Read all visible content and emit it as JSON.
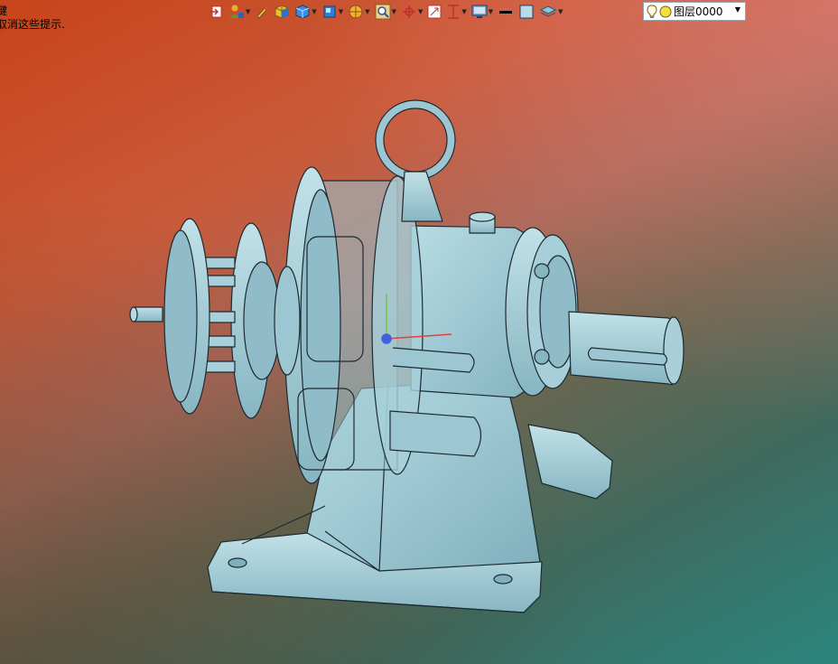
{
  "hint": {
    "line1": "键",
    "line2": "取消这些提示."
  },
  "toolbar": {
    "items": [
      "exit-sketch-icon",
      "user-tool-icon",
      "pencil-icon",
      "shaded-box-icon",
      "view-cube-icon",
      "iso-view-icon",
      "render-mode-icon",
      "zoom-icon",
      "pan-origin-icon",
      "fit-view-icon",
      "section-view-icon",
      "monitor-display-icon",
      "line-style-icon",
      "fill-color-icon",
      "layer-manager-icon"
    ]
  },
  "layer": {
    "name": "图层0000"
  },
  "colors": {
    "model_fill": "#9cc7d2",
    "model_edge": "#1e2a30",
    "background_top": "#c8441a",
    "background_bottom": "#2a857d"
  },
  "viewport": {
    "object": "cycloidal-gear-reducer-model"
  }
}
